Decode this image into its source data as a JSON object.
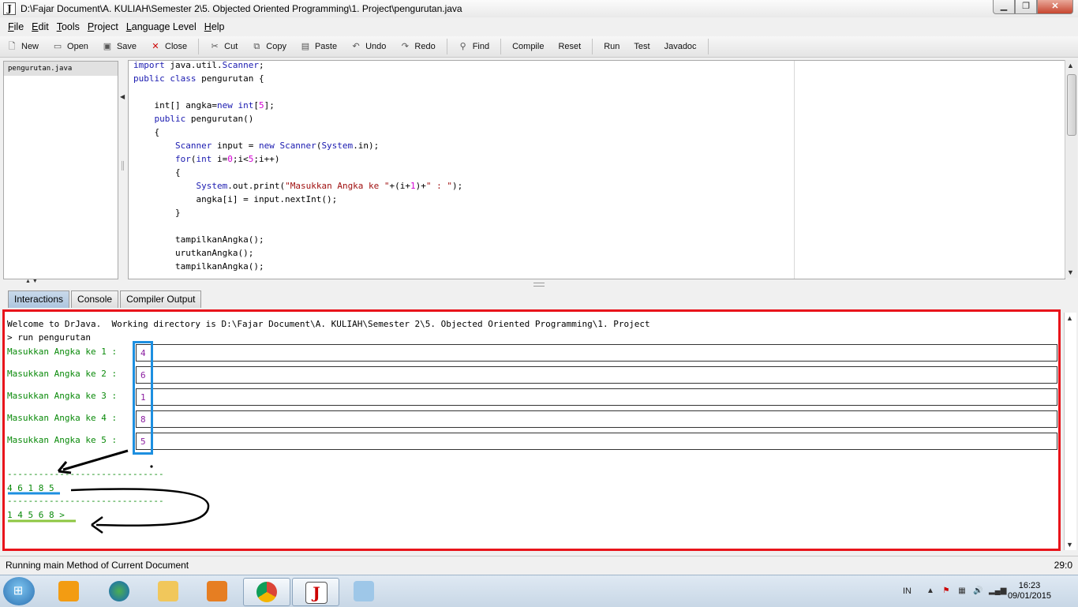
{
  "window": {
    "title": "D:\\Fajar Document\\A. KULIAH\\Semester 2\\5. Objected Oriented Programming\\1. Project\\pengurutan.java",
    "controls": [
      "minimize",
      "maximize",
      "close"
    ]
  },
  "menu": [
    {
      "mnemonic": "F",
      "rest": "ile"
    },
    {
      "mnemonic": "E",
      "rest": "dit"
    },
    {
      "mnemonic": "T",
      "rest": "ools"
    },
    {
      "mnemonic": "P",
      "rest": "roject"
    },
    {
      "mnemonic": "L",
      "rest": "anguage Level"
    },
    {
      "mnemonic": "H",
      "rest": "elp"
    }
  ],
  "toolbar": {
    "new": "New",
    "open": "Open",
    "save": "Save",
    "close": "Close",
    "cut": "Cut",
    "copy": "Copy",
    "paste": "Paste",
    "undo": "Undo",
    "redo": "Redo",
    "find": "Find",
    "compile": "Compile",
    "reset": "Reset",
    "run": "Run",
    "test": "Test",
    "javadoc": "Javadoc"
  },
  "files": [
    "pengurutan.java"
  ],
  "editor": {
    "lines": [
      "import java.util.Scanner;",
      "public class pengurutan {",
      "",
      "    int[] angka=new int[5];",
      "    public pengurutan()",
      "    {",
      "        Scanner input = new Scanner(System.in);",
      "        for(int i=0;i<5;i++)",
      "        {",
      "            System.out.print(\"Masukkan Angka ke \"+(i+1)+\" : \");",
      "            angka[i] = input.nextInt();",
      "        }",
      "",
      "        tampilkanAngka();",
      "        urutkanAngka();",
      "        tampilkanAngka();"
    ]
  },
  "tabs": [
    "Interactions",
    "Console",
    "Compiler Output"
  ],
  "interactions": {
    "welcome": "Welcome to DrJava.  Working directory is D:\\Fajar Document\\A. KULIAH\\Semester 2\\5. Objected Oriented Programming\\1. Project",
    "command": "> run pengurutan",
    "prompts": [
      {
        "label": "Masukkan Angka ke 1 :",
        "value": "4"
      },
      {
        "label": "Masukkan Angka ke 2 :",
        "value": "6"
      },
      {
        "label": "Masukkan Angka ke 3 :",
        "value": "1"
      },
      {
        "label": "Masukkan Angka ke 4 :",
        "value": "8"
      },
      {
        "label": "Masukkan Angka ke 5 :",
        "value": "5"
      }
    ],
    "separator": "------------------------------",
    "before_sort": "4 6 1 8 5",
    "after_sort": "1 4 5 6 8 >",
    "annotation_colors": {
      "box": "#e8141b",
      "input_box": "#1d8fe0",
      "underline_1": "#1d8fe0",
      "underline_2": "#8cc63f",
      "arrow": "#000000"
    }
  },
  "status": {
    "message": "Running main Method of Current Document",
    "position": "29:0"
  },
  "taskbar": {
    "apps": [
      "media-player",
      "internet-download-manager",
      "file-explorer",
      "winamp",
      "chrome",
      "drjava",
      "notepad"
    ],
    "language": "IN",
    "time": "16:23",
    "date": "09/01/2015"
  }
}
